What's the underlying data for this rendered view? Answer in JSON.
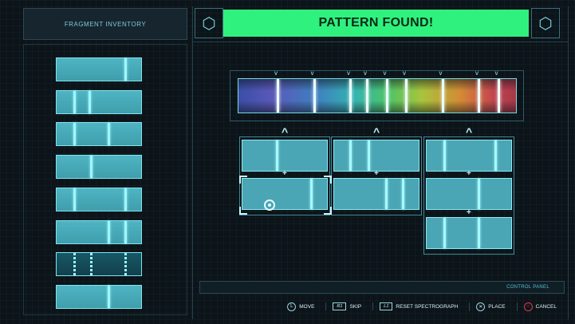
{
  "inventory": {
    "title": "FRAGMENT INVENTORY"
  },
  "banner": {
    "text": "PATTERN FOUND!"
  },
  "spectrograph": {
    "lines": [
      0.14,
      0.27,
      0.4,
      0.46,
      0.53,
      0.6,
      0.73,
      0.86,
      0.93
    ],
    "markers": [
      0.14,
      0.27,
      0.4,
      0.46,
      0.53,
      0.6,
      0.73,
      0.86,
      0.93
    ]
  },
  "fragments": [
    {
      "lines": [
        0.8
      ]
    },
    {
      "lines": [
        0.2,
        0.38
      ]
    },
    {
      "lines": [
        0.2,
        0.6
      ]
    },
    {
      "lines": [
        0.4
      ]
    },
    {
      "lines": [
        0.2,
        0.8
      ]
    },
    {
      "lines": [
        0.6,
        0.8
      ]
    },
    {
      "lines": [
        0.2,
        0.4,
        0.8
      ],
      "dark": true
    },
    {
      "lines": [
        0.6
      ]
    }
  ],
  "grid": {
    "columns": [
      {
        "slots": [
          {
            "lines": [
              0.4
            ]
          },
          {
            "lines": [
              0.8
            ]
          }
        ]
      },
      {
        "slots": [
          {
            "lines": [
              0.18,
              0.4
            ]
          },
          {
            "lines": [
              0.6,
              0.8
            ]
          }
        ]
      },
      {
        "slots": [
          {
            "lines": [
              0.2,
              0.8
            ]
          },
          {
            "lines": [
              0.6
            ]
          },
          {
            "lines": [
              0.2,
              0.6
            ]
          }
        ]
      }
    ]
  },
  "control_panel": {
    "title": "CONTROL PANEL",
    "actions": [
      {
        "button": "L",
        "label": "MOVE",
        "style": "round",
        "icon": "left-stick-icon"
      },
      {
        "button": "R1",
        "label": "SKIP",
        "style": "rect",
        "icon": "r1-button-icon"
      },
      {
        "button": "L1",
        "label": "RESET SPECTROGRAPH",
        "style": "rect",
        "icon": "l1-button-icon"
      },
      {
        "button": "✕",
        "label": "PLACE",
        "style": "round",
        "icon": "cross-button-icon"
      },
      {
        "button": "○",
        "label": "CANCEL",
        "style": "round",
        "icon": "circle-button-icon",
        "color": "#e0394a"
      }
    ]
  }
}
